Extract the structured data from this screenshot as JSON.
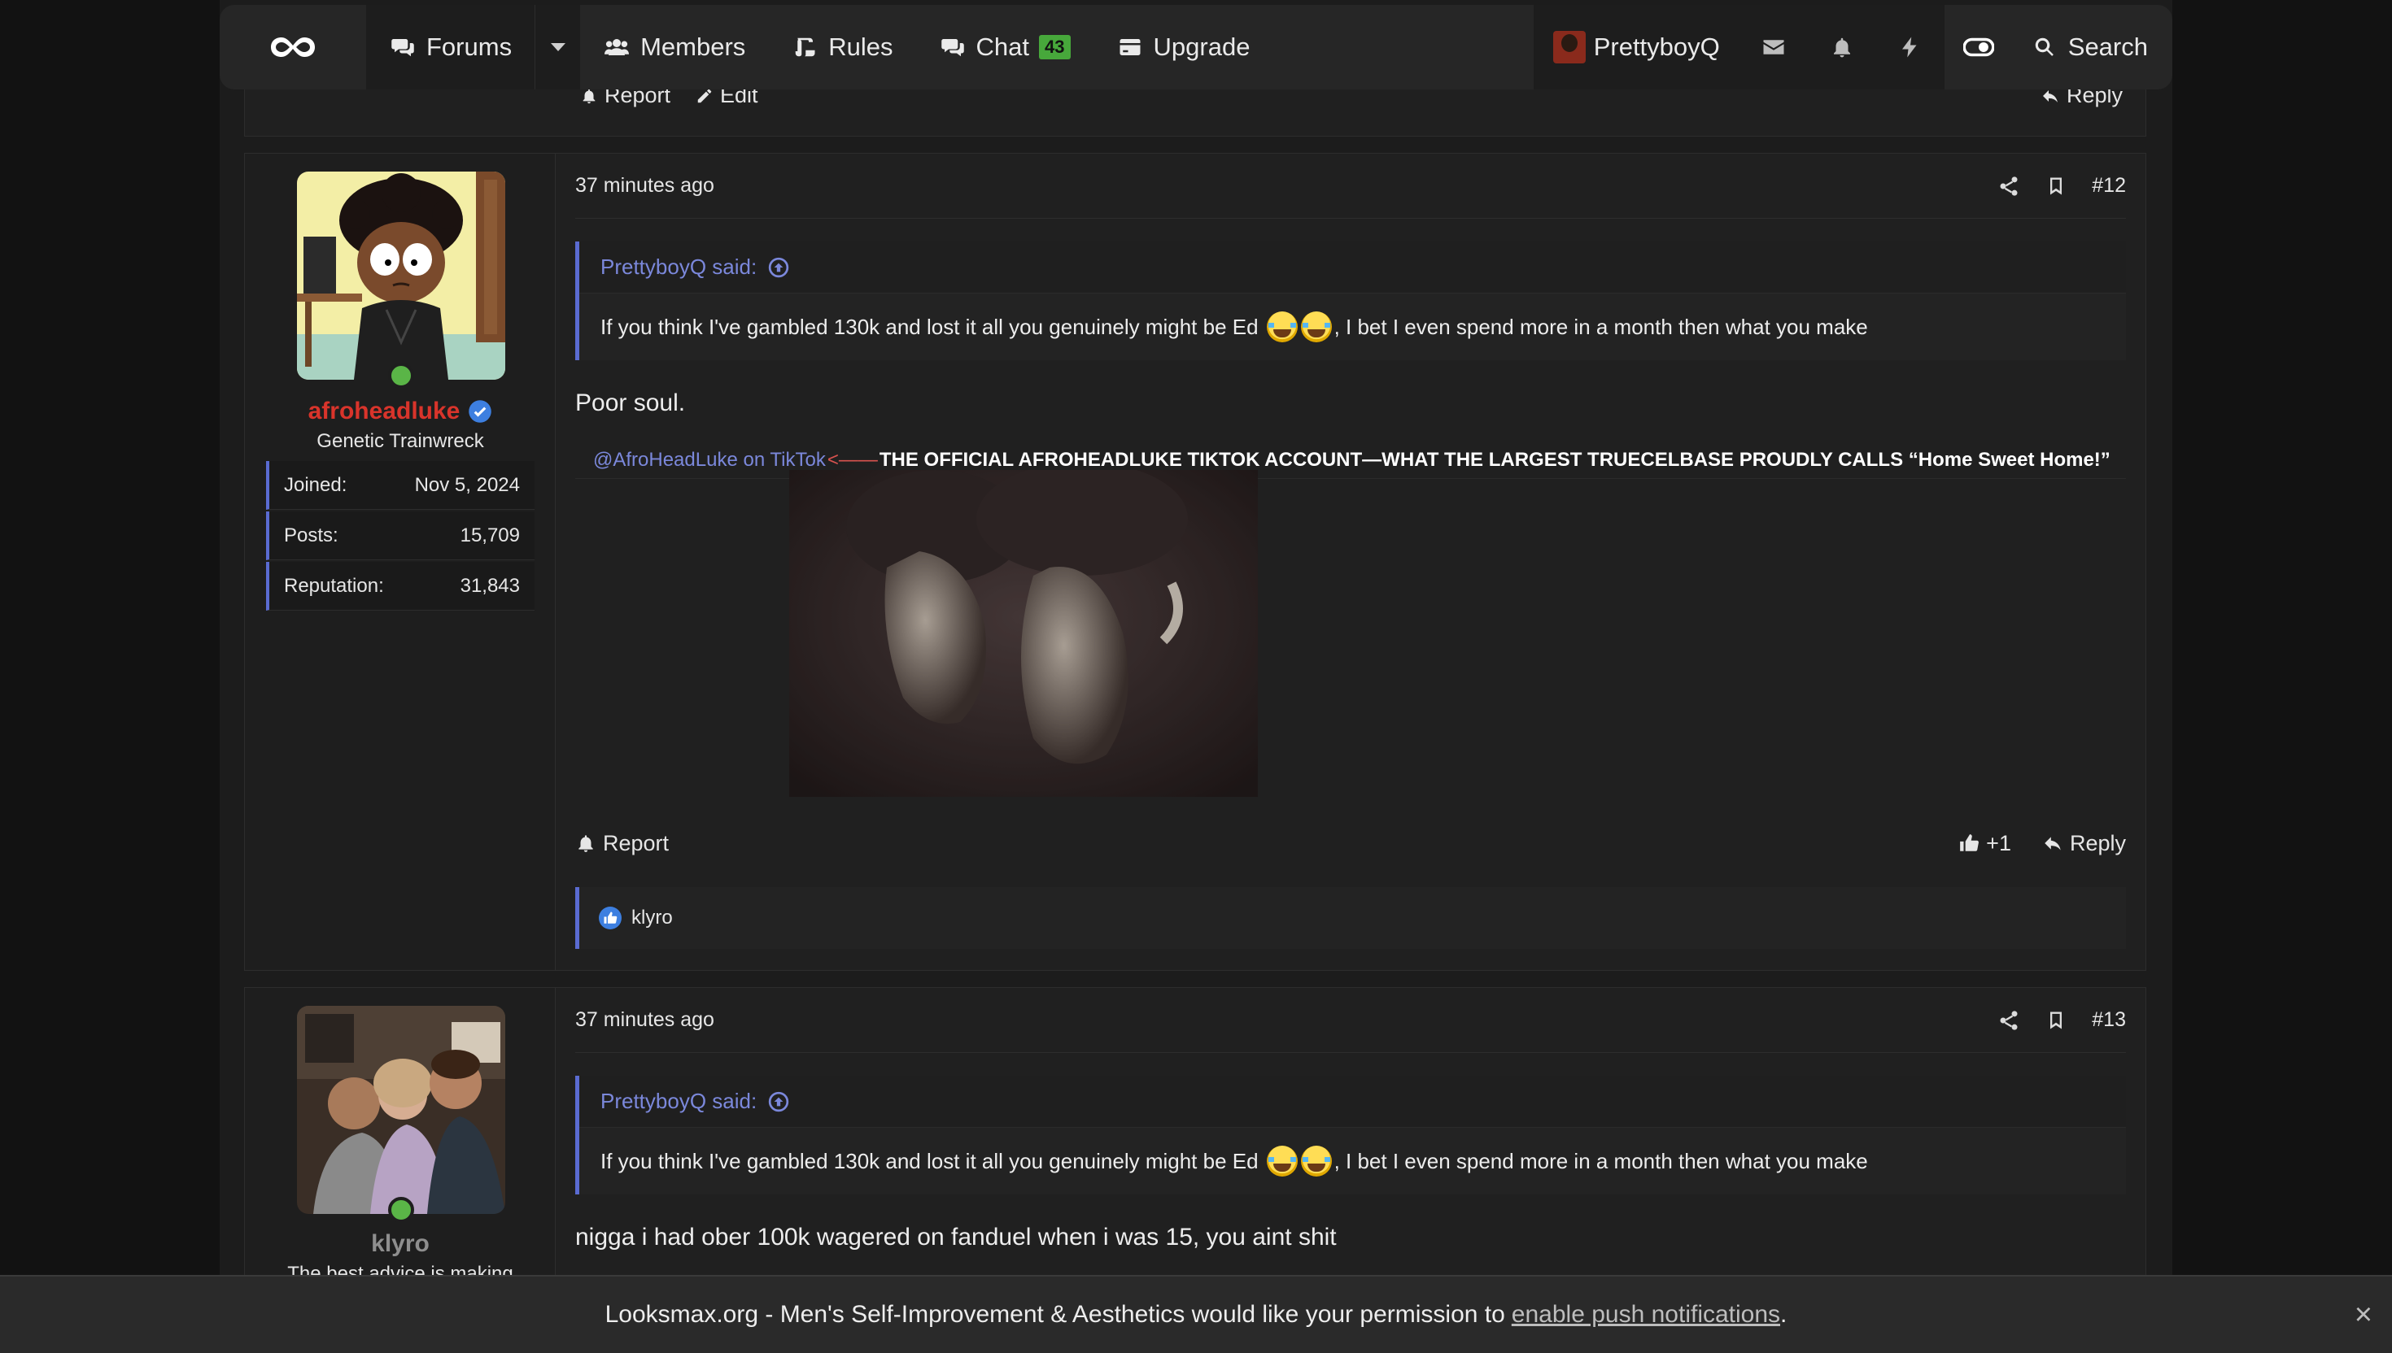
{
  "nav": {
    "forums": "Forums",
    "members": "Members",
    "rules": "Rules",
    "chat": "Chat",
    "chat_badge": "43",
    "upgrade": "Upgrade",
    "username": "PrettyboyQ",
    "search": "Search"
  },
  "prev_post": {
    "report": "Report",
    "edit": "Edit",
    "reply": "Reply"
  },
  "posts": [
    {
      "number": "#12",
      "time": "37 minutes ago",
      "user": {
        "name": "afroheadluke",
        "title": "Genetic Trainwreck",
        "name_color": "#d9342b",
        "stats": [
          {
            "label": "Joined:",
            "value": "Nov 5, 2024"
          },
          {
            "label": "Posts:",
            "value": "15,709"
          },
          {
            "label": "Reputation:",
            "value": "31,843"
          }
        ]
      },
      "quote": {
        "author": "PrettyboyQ said:",
        "text_before": "If you think I've gambled 130k and lost it all you genuinely might be Ed",
        "text_after": ", I bet I even spend more in a month then what you make"
      },
      "body": "Poor soul.",
      "signature": {
        "link": "@AfroHeadLuke on TikTok",
        "arrow": "<——",
        "bold": "THE OFFICIAL AFROHEADLUKE TIKTOK ACCOUNT—WHAT THE LARGEST TRUECELBASE PROUDLY CALLS “Home Sweet Home!”"
      },
      "actions": {
        "report": "Report",
        "likes": "+1",
        "reply": "Reply"
      },
      "reactions": {
        "user": "klyro"
      }
    },
    {
      "number": "#13",
      "time": "37 minutes ago",
      "user": {
        "name": "klyro",
        "title": "The best advice is making"
      },
      "quote": {
        "author": "PrettyboyQ said:",
        "text_before": "If you think I've gambled 130k and lost it all you genuinely might be Ed",
        "text_after": ", I bet I even spend more in a month then what you make"
      },
      "body": "nigga i had ober 100k wagered on fanduel when i was 15, you aint shit"
    }
  ],
  "push_banner": {
    "text": "Looksmax.org - Men's Self-Improvement & Aesthetics would like your permission to",
    "link": "enable push notifications",
    "end": ".",
    "close": "×"
  }
}
